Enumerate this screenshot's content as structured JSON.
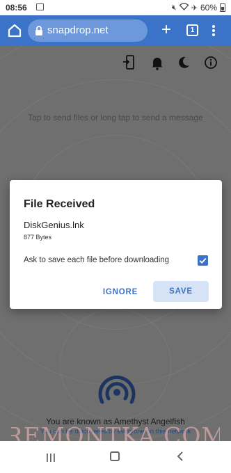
{
  "status_bar": {
    "time": "08:56",
    "battery": "60%"
  },
  "browser": {
    "url": "snapdrop.net",
    "tab_count": "1"
  },
  "page": {
    "hint": "Tap to send files or long tap to send a message",
    "known_as": "You are known as Amethyst Angelfish",
    "discoverable": "You can be discovered by everyone on this network"
  },
  "dialog": {
    "title": "File Received",
    "file_name": "DiskGenius.lnk",
    "file_size": "877 Bytes",
    "ask_label": "Ask to save each file before downloading",
    "ask_checked": true,
    "ignore_label": "IGNORE",
    "save_label": "SAVE"
  },
  "watermark": "REMONTKA.COM",
  "colors": {
    "accent": "#3b73c9",
    "overlay": "#6f6f6f",
    "save_bg": "#d6e2f5"
  }
}
